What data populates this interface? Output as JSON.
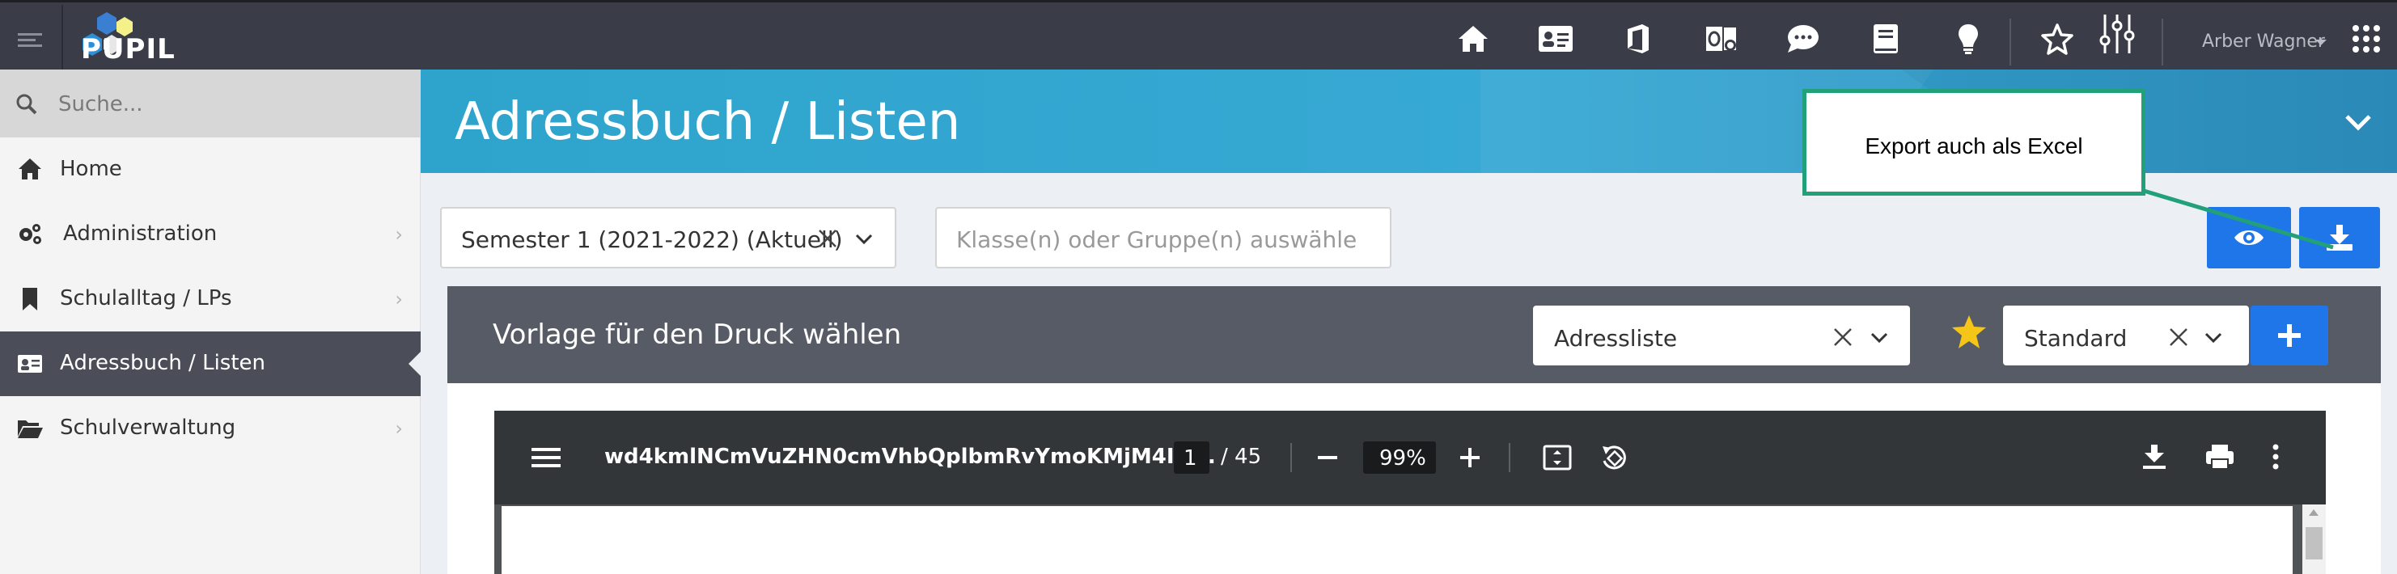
{
  "topbar": {
    "app_name": "PUPIL",
    "user_name": "Arber Wagner",
    "icons": [
      "home-icon",
      "contact-card-icon",
      "office-icon",
      "outlook-icon",
      "chat-icon",
      "book-icon",
      "lightbulb-icon",
      "star-icon",
      "sliders-icon",
      "apps-grid-icon"
    ]
  },
  "sidebar": {
    "search_placeholder": "Suche...",
    "items": [
      {
        "label": "Home",
        "icon": "home-icon",
        "chevron": ""
      },
      {
        "label": "Administration",
        "icon": "cogs-icon",
        "chevron": "›"
      },
      {
        "label": "Schulalltag / LPs",
        "icon": "bookmark-icon",
        "chevron": "›"
      },
      {
        "label": "Adressbuch / Listen",
        "icon": "address-card-icon",
        "chevron": ""
      },
      {
        "label": "Schulverwaltung",
        "icon": "folder-open-icon",
        "chevron": "›"
      }
    ],
    "active_index": 3
  },
  "header": {
    "title": "Adressbuch / Listen"
  },
  "filters": {
    "semester_value": "Semester 1 (2021-2022) (Aktuell)",
    "class_placeholder": "Klasse(n) oder Gruppe(n) auswähle"
  },
  "callout": {
    "text": "Export auch als Excel"
  },
  "print_panel": {
    "title": "Vorlage für den Druck wählen",
    "template_value": "Adressliste",
    "preset_value": "Standard"
  },
  "pdf_viewer": {
    "filename": "wd4kmlNCmVuZHN0cmVhbQplbmRvYmoKMjM4ID...",
    "page_current": "1",
    "page_total": "/ 45",
    "zoom": "99%"
  },
  "colors": {
    "topbar": "#3a3d47",
    "header": "#37a9d4",
    "accent_blue": "#1f76e8",
    "callout_border": "#21a07a",
    "star": "#f5c518"
  }
}
